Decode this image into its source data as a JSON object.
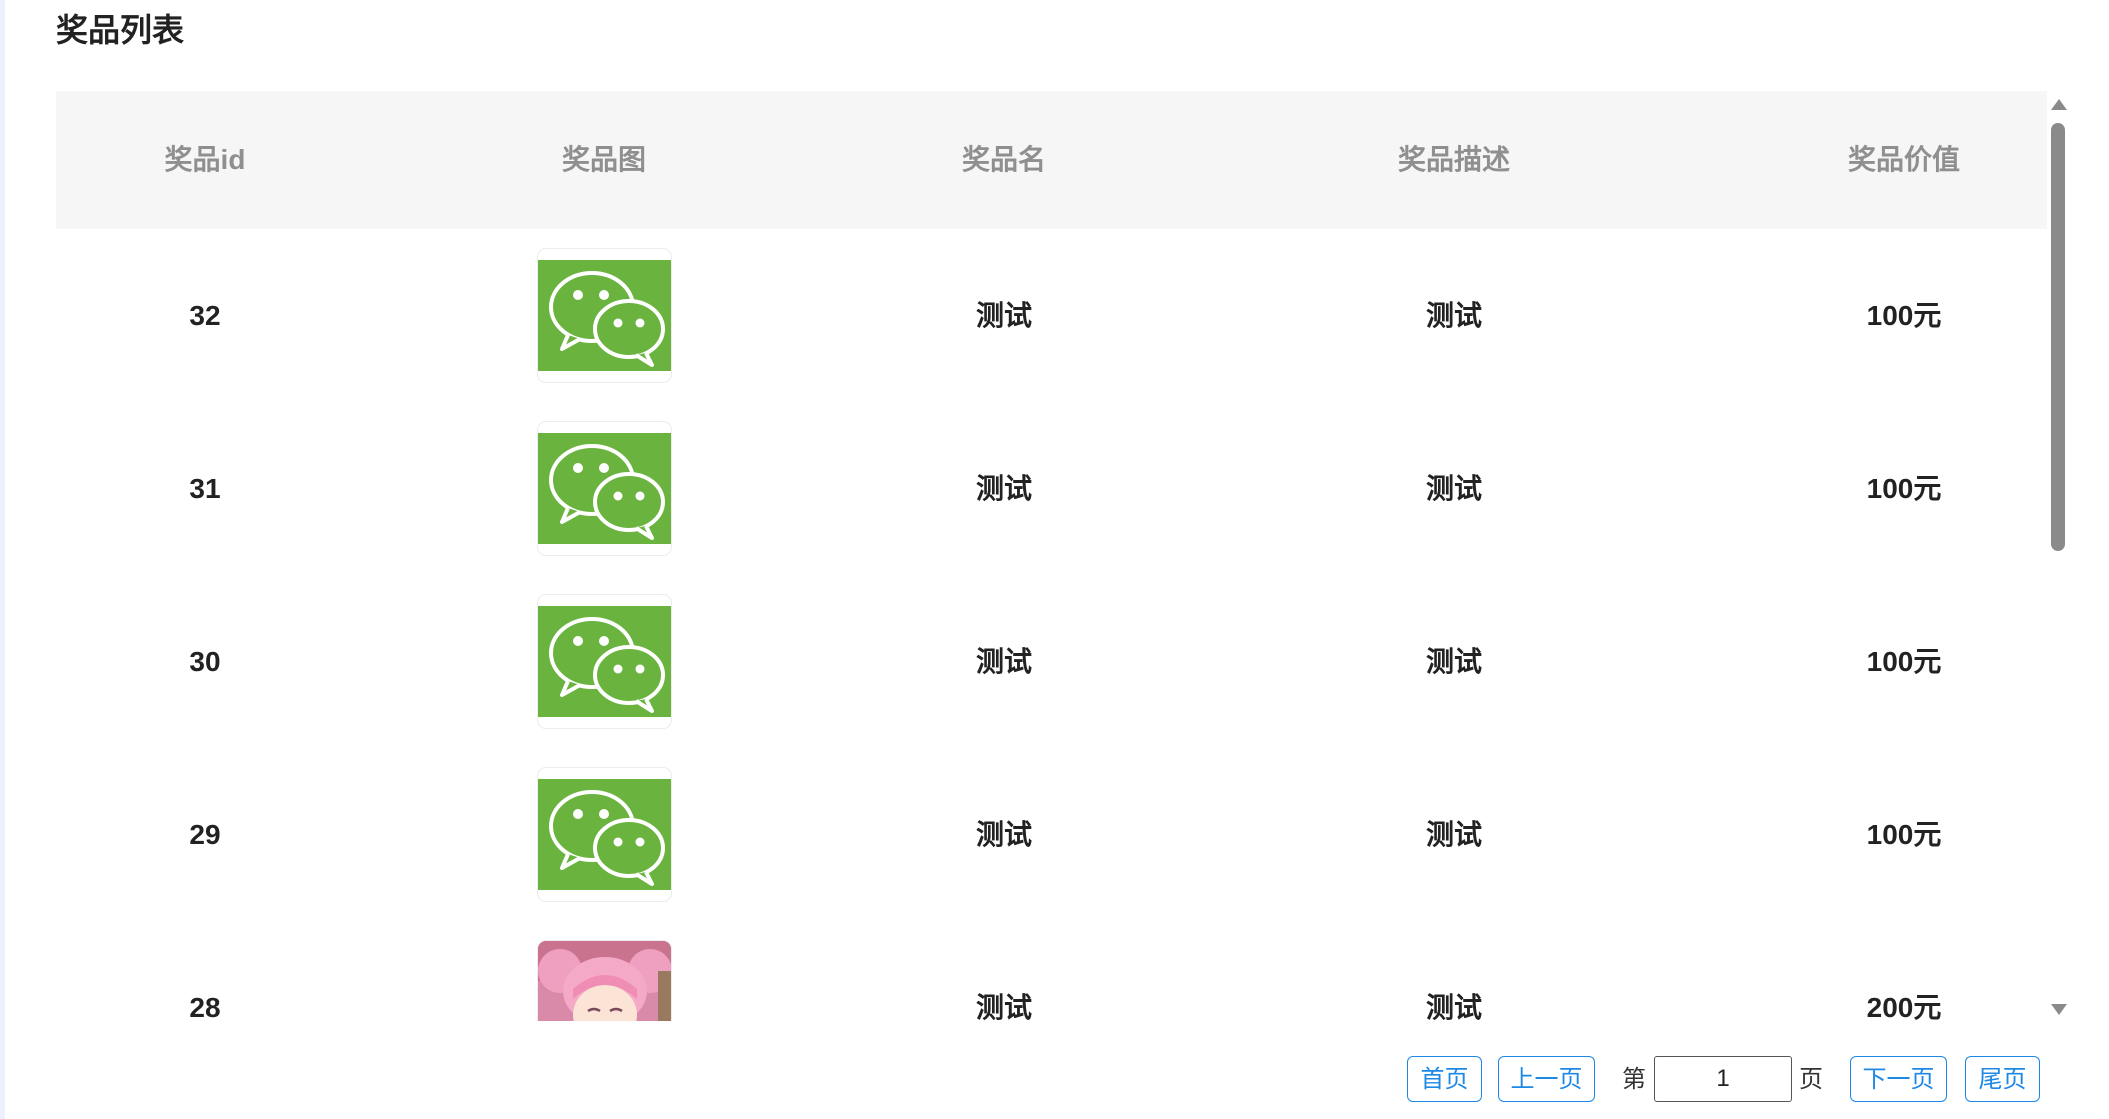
{
  "page": {
    "title": "奖品列表"
  },
  "table": {
    "columns": [
      "奖品id",
      "奖品图",
      "奖品名",
      "奖品描述",
      "奖品价值"
    ],
    "rows": [
      {
        "id": "32",
        "image_icon": "wechat-icon",
        "name": "测试",
        "description": "测试",
        "value": "100元"
      },
      {
        "id": "31",
        "image_icon": "wechat-icon",
        "name": "测试",
        "description": "测试",
        "value": "100元"
      },
      {
        "id": "30",
        "image_icon": "wechat-icon",
        "name": "测试",
        "description": "测试",
        "value": "100元"
      },
      {
        "id": "29",
        "image_icon": "wechat-icon",
        "name": "测试",
        "description": "测试",
        "value": "100元"
      },
      {
        "id": "28",
        "image_icon": "anime-character-image",
        "name": "测试",
        "description": "测试",
        "value": "200元"
      }
    ]
  },
  "pagination": {
    "first_label": "首页",
    "prev_label": "上一页",
    "page_prefix": "第",
    "current_page": "1",
    "page_suffix": "页",
    "next_label": "下一页",
    "last_label": "尾页"
  },
  "colors": {
    "accent": "#1e88e5",
    "wechat_green": "#6ab33f",
    "header_bg": "#f6f6f6"
  }
}
